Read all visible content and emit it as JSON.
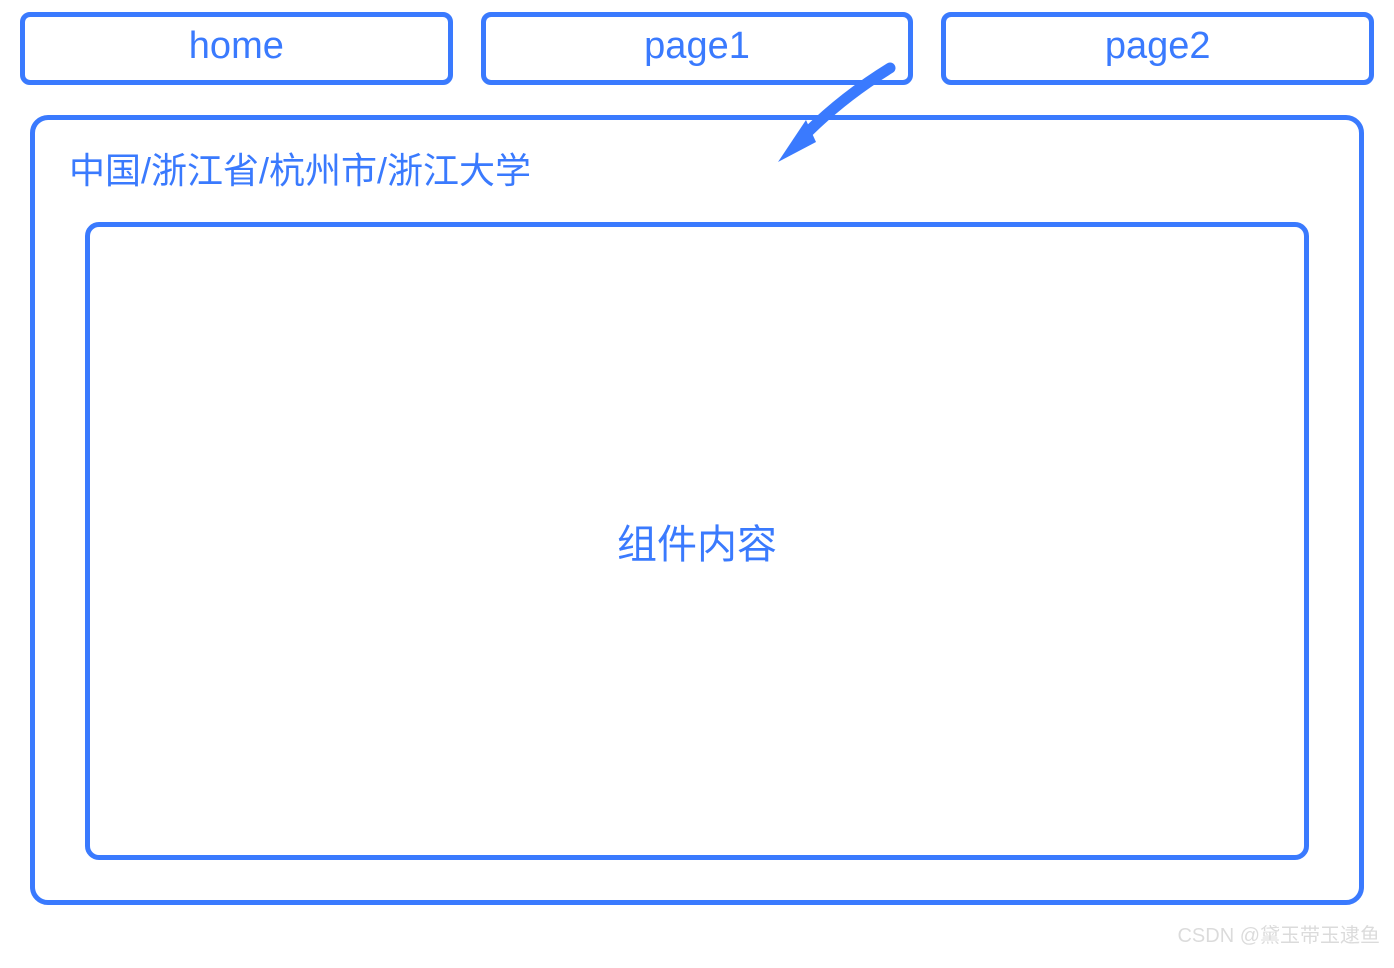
{
  "tabs": [
    {
      "label": "home"
    },
    {
      "label": "page1"
    },
    {
      "label": "page2"
    }
  ],
  "breadcrumb": "中国/浙江省/杭州市/浙江大学",
  "content_label": "组件内容",
  "watermark": "CSDN @黛玉带玉逮鱼",
  "colors": {
    "primary": "#3a7afe"
  }
}
